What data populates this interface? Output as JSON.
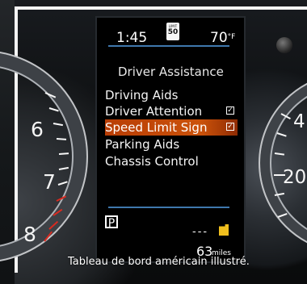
{
  "display": {
    "time": "1:45",
    "temperature": "70",
    "temperature_unit": "°F",
    "speed_limit_caption": "LIMIT",
    "speed_limit_value": "50",
    "section_title": "Driver Assistance",
    "menu_items": [
      {
        "label": "Driving Aids",
        "checked": false,
        "selected": false
      },
      {
        "label": "Driver Attention",
        "checked": true,
        "selected": false
      },
      {
        "label": "Speed Limit Sign",
        "checked": true,
        "selected": true
      },
      {
        "label": "Parking Aids",
        "checked": false,
        "selected": false
      },
      {
        "label": "Chassis Control",
        "checked": false,
        "selected": false
      }
    ],
    "gear": "P",
    "fuel_placeholder": "---",
    "range_value": "63",
    "range_unit": "miles"
  },
  "gauges": {
    "left_numbers": [
      "6",
      "7",
      "8"
    ],
    "right_numbers": [
      "4",
      "20"
    ]
  },
  "caption": "Tableau de bord américain illustré.",
  "colors": {
    "selection": "#cb520a",
    "accent_line": "#3f78ad",
    "fuel_icon": "#f0bf1e",
    "redline": "#d82a20"
  }
}
